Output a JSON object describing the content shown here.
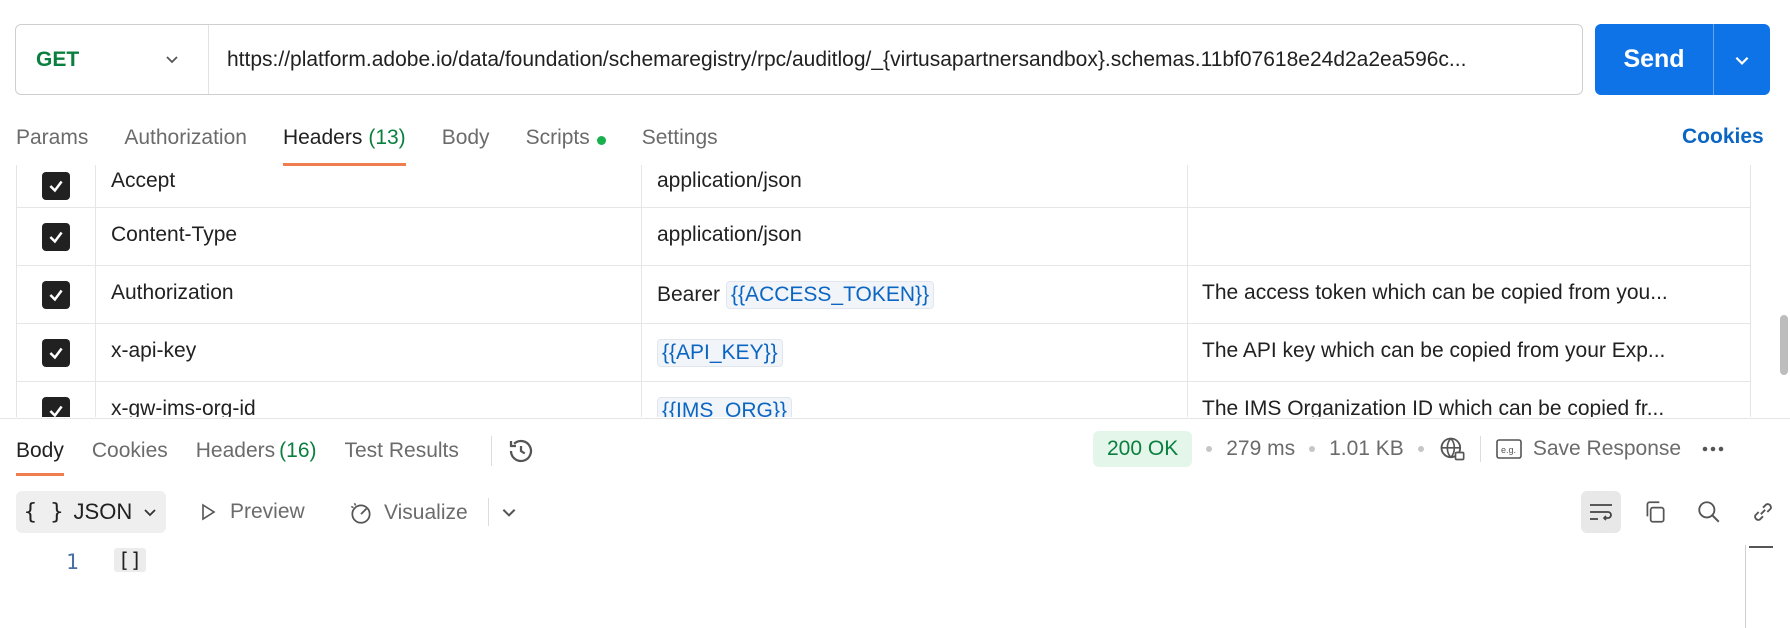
{
  "request": {
    "method": "GET",
    "url": "https://platform.adobe.io/data/foundation/schemaregistry/rpc/auditlog/_{virtusapartnersandbox}.schemas.11bf07618e24d2a2ea596c...",
    "send_label": "Send"
  },
  "tabs": [
    {
      "label": "Params"
    },
    {
      "label": "Authorization"
    },
    {
      "label": "Headers",
      "count": "(13)"
    },
    {
      "label": "Body"
    },
    {
      "label": "Scripts"
    },
    {
      "label": "Settings"
    }
  ],
  "cookies_link": "Cookies",
  "headers": [
    {
      "key": "Accept",
      "value": "application/json",
      "value_var": "",
      "description": ""
    },
    {
      "key": "Content-Type",
      "value": "application/json",
      "value_var": "",
      "description": ""
    },
    {
      "key": "Authorization",
      "value": "Bearer",
      "value_var": "{{ACCESS_TOKEN}}",
      "description": "The access token which can be copied from you..."
    },
    {
      "key": "x-api-key",
      "value": "",
      "value_var": "{{API_KEY}}",
      "description": "The API key which can be copied from your Exp..."
    },
    {
      "key": "x-gw-ims-org-id",
      "value": "",
      "value_var": "{{IMS_ORG}}",
      "description": "The IMS Organization ID which can be copied fr..."
    }
  ],
  "response": {
    "tabs": [
      {
        "label": "Body"
      },
      {
        "label": "Cookies"
      },
      {
        "label": "Headers",
        "count": "(16)"
      },
      {
        "label": "Test Results"
      }
    ],
    "status": "200 OK",
    "time": "279 ms",
    "size": "1.01 KB",
    "save_label": "Save Response",
    "format": "JSON",
    "preview_label": "Preview",
    "visualize_label": "Visualize",
    "line_number": "1",
    "body": "[]"
  },
  "colors": {
    "accent": "#0e73e6",
    "method_green": "#0b7f3f",
    "active_tab_underline": "#ef7d4d",
    "link_blue": "#0b66c3"
  }
}
